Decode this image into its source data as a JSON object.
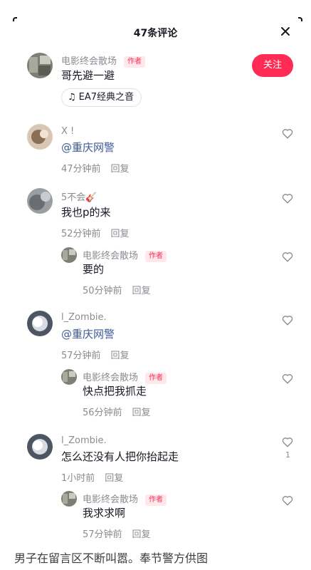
{
  "header": {
    "title": "47条评论"
  },
  "comments": [
    {
      "user": "电影终会散场",
      "badge": "作者",
      "text": "哥先避一避",
      "follow": "关注",
      "music": "EA7经典之音"
    },
    {
      "user": "X !",
      "mention": "@重庆网警",
      "time": "47分钟前",
      "reply": "回复"
    },
    {
      "user": "5不会🎸",
      "text": "我也p的来",
      "time": "52分钟前",
      "reply": "回复"
    },
    {
      "user": "电影终会散场",
      "badge": "作者",
      "text": "要的",
      "time": "50分钟前",
      "reply": "回复"
    },
    {
      "user": "l_Zombie.",
      "mention": "@重庆网警",
      "time": "57分钟前",
      "reply": "回复"
    },
    {
      "user": "电影终会散场",
      "badge": "作者",
      "text": "快点把我抓走",
      "time": "56分钟前",
      "reply": "回复"
    },
    {
      "user": "l_Zombie.",
      "text": "怎么还没有人把你抬起走",
      "time": "1小时前",
      "reply": "回复",
      "likes": "1"
    },
    {
      "user": "电影终会散场",
      "badge": "作者",
      "text": "我求求啊",
      "time": "57分钟前",
      "reply": "回复"
    }
  ],
  "caption": "男子在留言区不断叫嚣。奉节警方供图",
  "colors": {
    "accent": "#fe2c55",
    "mention": "#3e5a96",
    "meta": "#8a8b91"
  },
  "icons": {
    "close": "close-icon",
    "like": "heart-outline-icon",
    "music": "music-note-icon"
  }
}
